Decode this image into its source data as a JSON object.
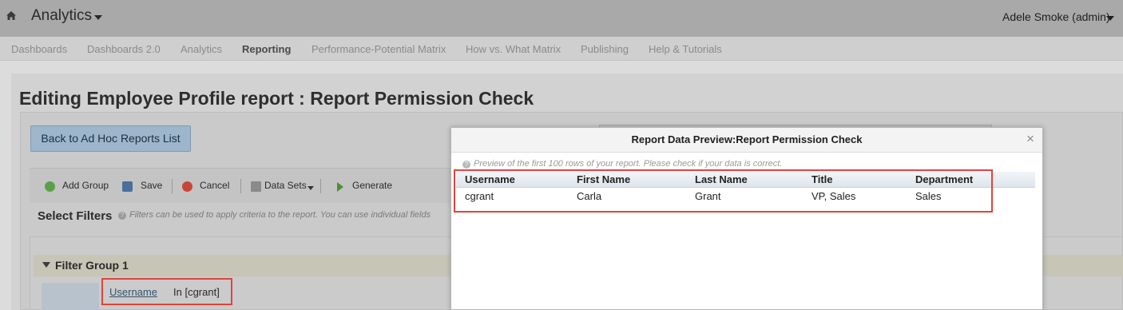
{
  "header": {
    "app_title": "Analytics",
    "user": "Adele Smoke (admin)"
  },
  "nav": {
    "items": [
      {
        "label": "Dashboards"
      },
      {
        "label": "Dashboards 2.0"
      },
      {
        "label": "Analytics"
      },
      {
        "label": "Reporting",
        "active": true
      },
      {
        "label": "Performance-Potential Matrix"
      },
      {
        "label": "How vs. What Matrix"
      },
      {
        "label": "Publishing"
      },
      {
        "label": "Help & Tutorials"
      }
    ]
  },
  "page": {
    "title": "Editing Employee Profile report : Report Permission Check",
    "back_button": "Back to Ad Hoc Reports List"
  },
  "toolbar": {
    "add_group": "Add Group",
    "save": "Save",
    "cancel": "Cancel",
    "data_sets": "Data Sets",
    "generate": "Generate"
  },
  "filters": {
    "title": "Select Filters",
    "help": "Filters can be used to apply criteria to the report. You can use individual fields",
    "group": {
      "title": "Filter Group 1",
      "field": "Username",
      "value": "In [cgrant]"
    }
  },
  "modal": {
    "title": "Report Data Preview:Report Permission Check",
    "close": "×",
    "note": "Preview of the first 100 rows of your report. Please check if your data is correct.",
    "columns": [
      "Username",
      "First Name",
      "Last Name",
      "Title",
      "Department"
    ],
    "rows": [
      [
        "cgrant",
        "Carla",
        "Grant",
        "VP, Sales",
        "Sales"
      ]
    ]
  },
  "colors": {
    "highlight": "#e0443c",
    "header_bg": "#a9a9a9"
  }
}
